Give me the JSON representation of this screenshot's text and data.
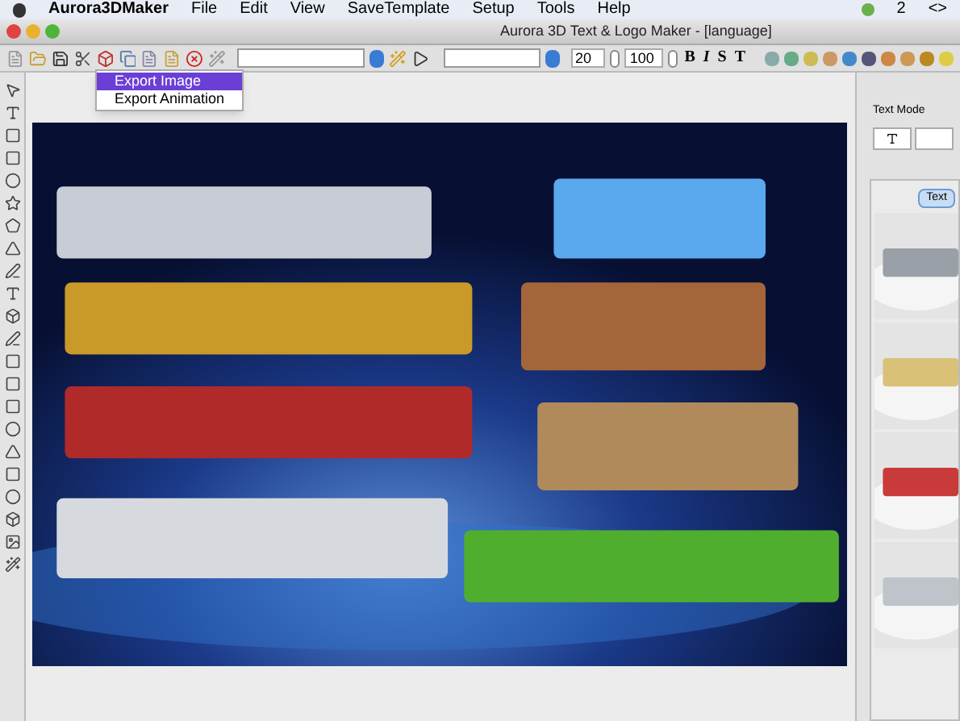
{
  "menu_bar": {
    "app": "Aurora3DMaker",
    "items": [
      "File",
      "Edit",
      "View",
      "SaveTemplate",
      "Setup",
      "Tools",
      "Help"
    ],
    "status": [
      "2",
      "<>"
    ]
  },
  "window": {
    "title": "Aurora 3D Text & Logo Maker - [language]"
  },
  "toolbar": {
    "size": "20",
    "scale": "100",
    "format_buttons": [
      "B",
      "I",
      "S",
      "T"
    ]
  },
  "export_menu": [
    {
      "label": "Export Image",
      "selected": true
    },
    {
      "label": "Export Animation",
      "selected": false
    }
  ],
  "side_panel": {
    "section": "Text Mode",
    "tab": "Text"
  }
}
